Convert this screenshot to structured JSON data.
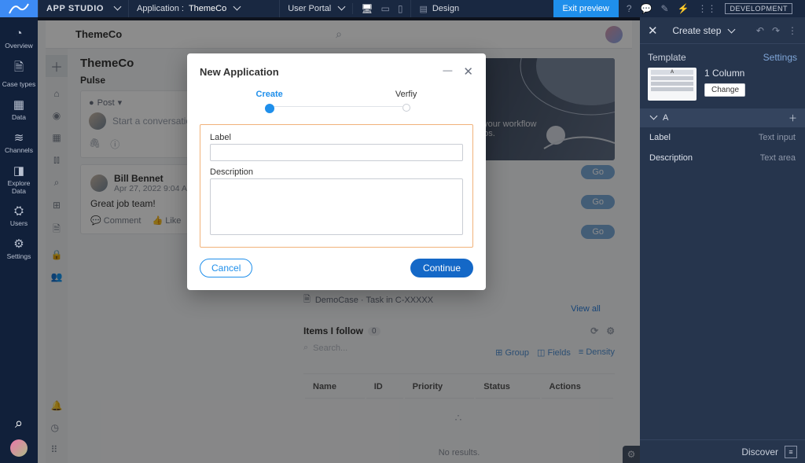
{
  "top": {
    "app_name": "APP STUDIO",
    "application_label": "Application :",
    "application_value": "ThemeCo",
    "perspective": "User Portal",
    "design_label": "Design",
    "exit_preview": "Exit preview",
    "env_badge": "DEVELOPMENT"
  },
  "leftrail": [
    {
      "icon": "◔",
      "label": "Overview"
    },
    {
      "icon": "🗎",
      "label": "Case types"
    },
    {
      "icon": "▦",
      "label": "Data"
    },
    {
      "icon": "≋",
      "label": "Channels"
    },
    {
      "icon": "◨",
      "label": "Explore Data"
    },
    {
      "icon": "⛭",
      "label": "Users"
    },
    {
      "icon": "⚙",
      "label": "Settings"
    }
  ],
  "userportal": {
    "header_title": "ThemeCo",
    "page_title": "ThemeCo",
    "pulse_heading": "Pulse",
    "post_pill": "Post",
    "conversation_placeholder": "Start a conversation",
    "post": {
      "author": "Bill Bennet",
      "timestamp": "Apr 27, 2022 9:04 AM",
      "body": "Great job team!",
      "comment_label": "Comment",
      "like_label": "Like"
    },
    "space_line1": "e your workflow",
    "space_line2": "mos.",
    "go_label": "Go",
    "feed_line": "DemoCase · Task in C-XXXXX",
    "view_all": "View all",
    "items_follow": {
      "heading": "Items I follow",
      "count": "0",
      "search_placeholder": "Search...",
      "opt_group": "Group",
      "opt_fields": "Fields",
      "opt_density": "Density",
      "columns": [
        "Name",
        "ID",
        "Priority",
        "Status",
        "Actions"
      ],
      "no_results": "No results."
    }
  },
  "modal": {
    "title": "New Application",
    "step1": "Create",
    "step2": "Verfiy",
    "label_label": "Label",
    "desc_label": "Description",
    "cancel": "Cancel",
    "continue": "Continue"
  },
  "rpanel": {
    "header_title": "Create step",
    "template_label": "Template",
    "settings_link": "Settings",
    "template_name": "1 Column",
    "change_label": "Change",
    "region_name": "A",
    "fields": [
      {
        "name": "Label",
        "type": "Text input"
      },
      {
        "name": "Description",
        "type": "Text area"
      }
    ],
    "discover": "Discover"
  }
}
